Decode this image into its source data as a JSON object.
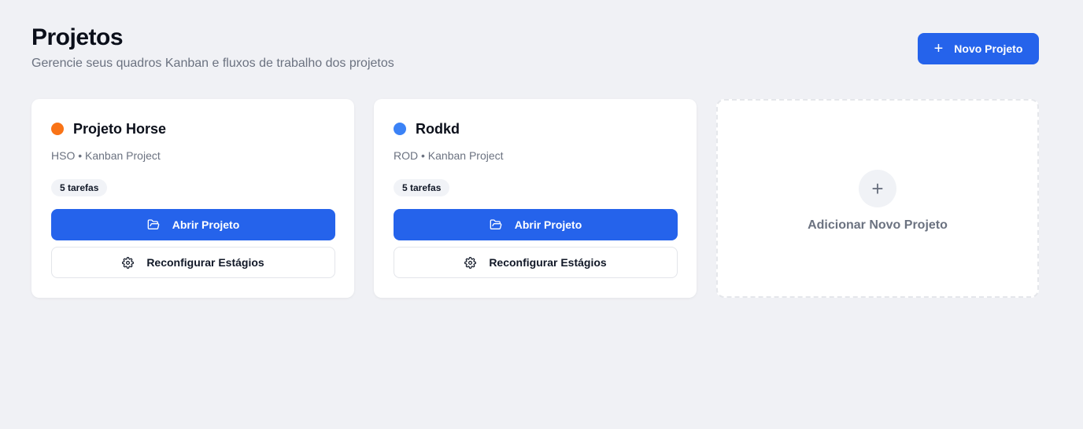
{
  "header": {
    "title": "Projetos",
    "subtitle": "Gerencie seus quadros Kanban e fluxos de trabalho dos projetos",
    "new_button_label": "Novo Projeto",
    "new_button_icon": "plus-icon"
  },
  "projects": [
    {
      "name": "Projeto Horse",
      "color": "#f97316",
      "meta": "HSO • Kanban Project",
      "task_count": "5 tarefas",
      "open_label": "Abrir Projeto",
      "open_icon": "folder-open-icon",
      "configure_label": "Reconfigurar Estágios",
      "configure_icon": "gear-icon"
    },
    {
      "name": "Rodkd",
      "color": "#3b82f6",
      "meta": "ROD • Kanban Project",
      "task_count": "5 tarefas",
      "open_label": "Abrir Projeto",
      "open_icon": "folder-open-icon",
      "configure_label": "Reconfigurar Estágios",
      "configure_icon": "gear-icon"
    }
  ],
  "add_card": {
    "label": "Adicionar Novo Projeto",
    "icon": "plus-icon"
  },
  "colors": {
    "primary": "#2563eb",
    "background": "#f0f1f5"
  }
}
